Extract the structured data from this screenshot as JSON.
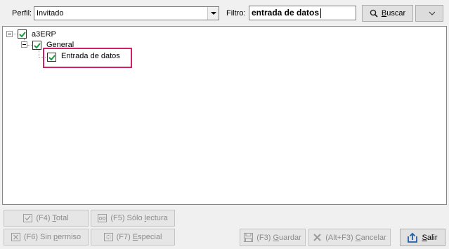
{
  "toolbar": {
    "profile_label": "Perfil:",
    "profile_value": "Invitado",
    "filter_label": "Filtro:",
    "filter_value": "entrada de datos",
    "search_button": {
      "pre": "",
      "mnemonic": "B",
      "post": "uscar",
      "icon": "search-icon"
    },
    "extra_dropdown_icon": "chevron-down-icon"
  },
  "tree": {
    "nodes": [
      {
        "label": "a3ERP",
        "checked": true,
        "expanded": true,
        "level": 0
      },
      {
        "label": "General",
        "checked": true,
        "expanded": true,
        "level": 1
      },
      {
        "label": "Entrada de datos",
        "checked": true,
        "level": 2,
        "highlighted": true
      }
    ],
    "highlight_color": "#d0206a",
    "check_color": "#1a9a3a"
  },
  "bottom_buttons": {
    "total": {
      "pre": "(F4) ",
      "mnemonic": "T",
      "post": "otal",
      "icon": "check-box-icon",
      "enabled": false
    },
    "read_only": {
      "pre": "(F5) Sólo ",
      "mnemonic": "l",
      "post": "ectura",
      "icon": "glasses-icon",
      "enabled": false
    },
    "no_permission": {
      "pre": "(F6) Sin ",
      "mnemonic": "p",
      "post": "ermiso",
      "icon": "x-box-icon",
      "enabled": false
    },
    "special": {
      "pre": "(F7) ",
      "mnemonic": "E",
      "post": "special",
      "icon": "special-box-icon",
      "enabled": false
    },
    "save": {
      "pre": "(F3) ",
      "mnemonic": "G",
      "post": "uardar",
      "icon": "floppy-disk-icon",
      "enabled": false
    },
    "cancel": {
      "pre": "(Alt+F3) ",
      "mnemonic": "C",
      "post": "ancelar",
      "icon": "x-icon",
      "enabled": false
    },
    "exit": {
      "pre": "",
      "mnemonic": "S",
      "post": "alir",
      "icon": "exit-icon",
      "enabled": true
    }
  }
}
